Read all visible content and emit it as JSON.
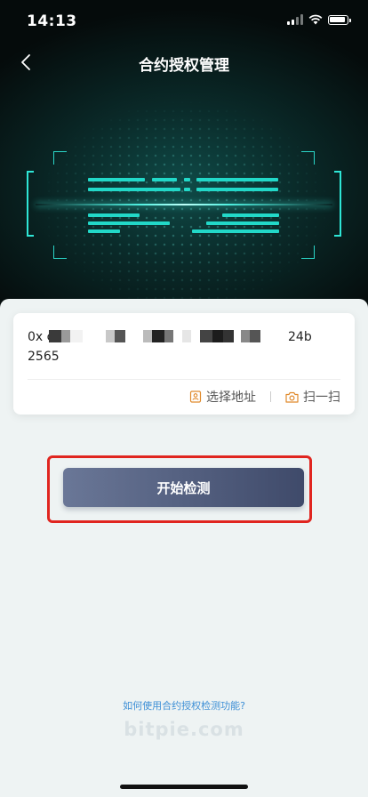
{
  "status_bar": {
    "time": "14:13",
    "signal_icon": "cellular-signal-icon",
    "wifi_icon": "wifi-icon",
    "battery_icon": "battery-icon"
  },
  "nav": {
    "title": "合约授权管理",
    "back_icon": "chevron-left-icon"
  },
  "hero": {
    "scan_color": "#22d8c8"
  },
  "address_card": {
    "prefix": "0x c",
    "suffix": "24b",
    "second_line": "2565",
    "select_address_label": "选择地址",
    "select_address_icon": "address-book-icon",
    "scan_label": "扫一扫",
    "scan_icon": "camera-icon",
    "action_color": "#e08a2c"
  },
  "start_button": {
    "label": "开始检测"
  },
  "help_link": {
    "label": "如何使用合约授权检测功能?"
  },
  "watermark": {
    "text": "bitpie.com"
  },
  "annotation": {
    "highlight_color": "#e0251f"
  }
}
